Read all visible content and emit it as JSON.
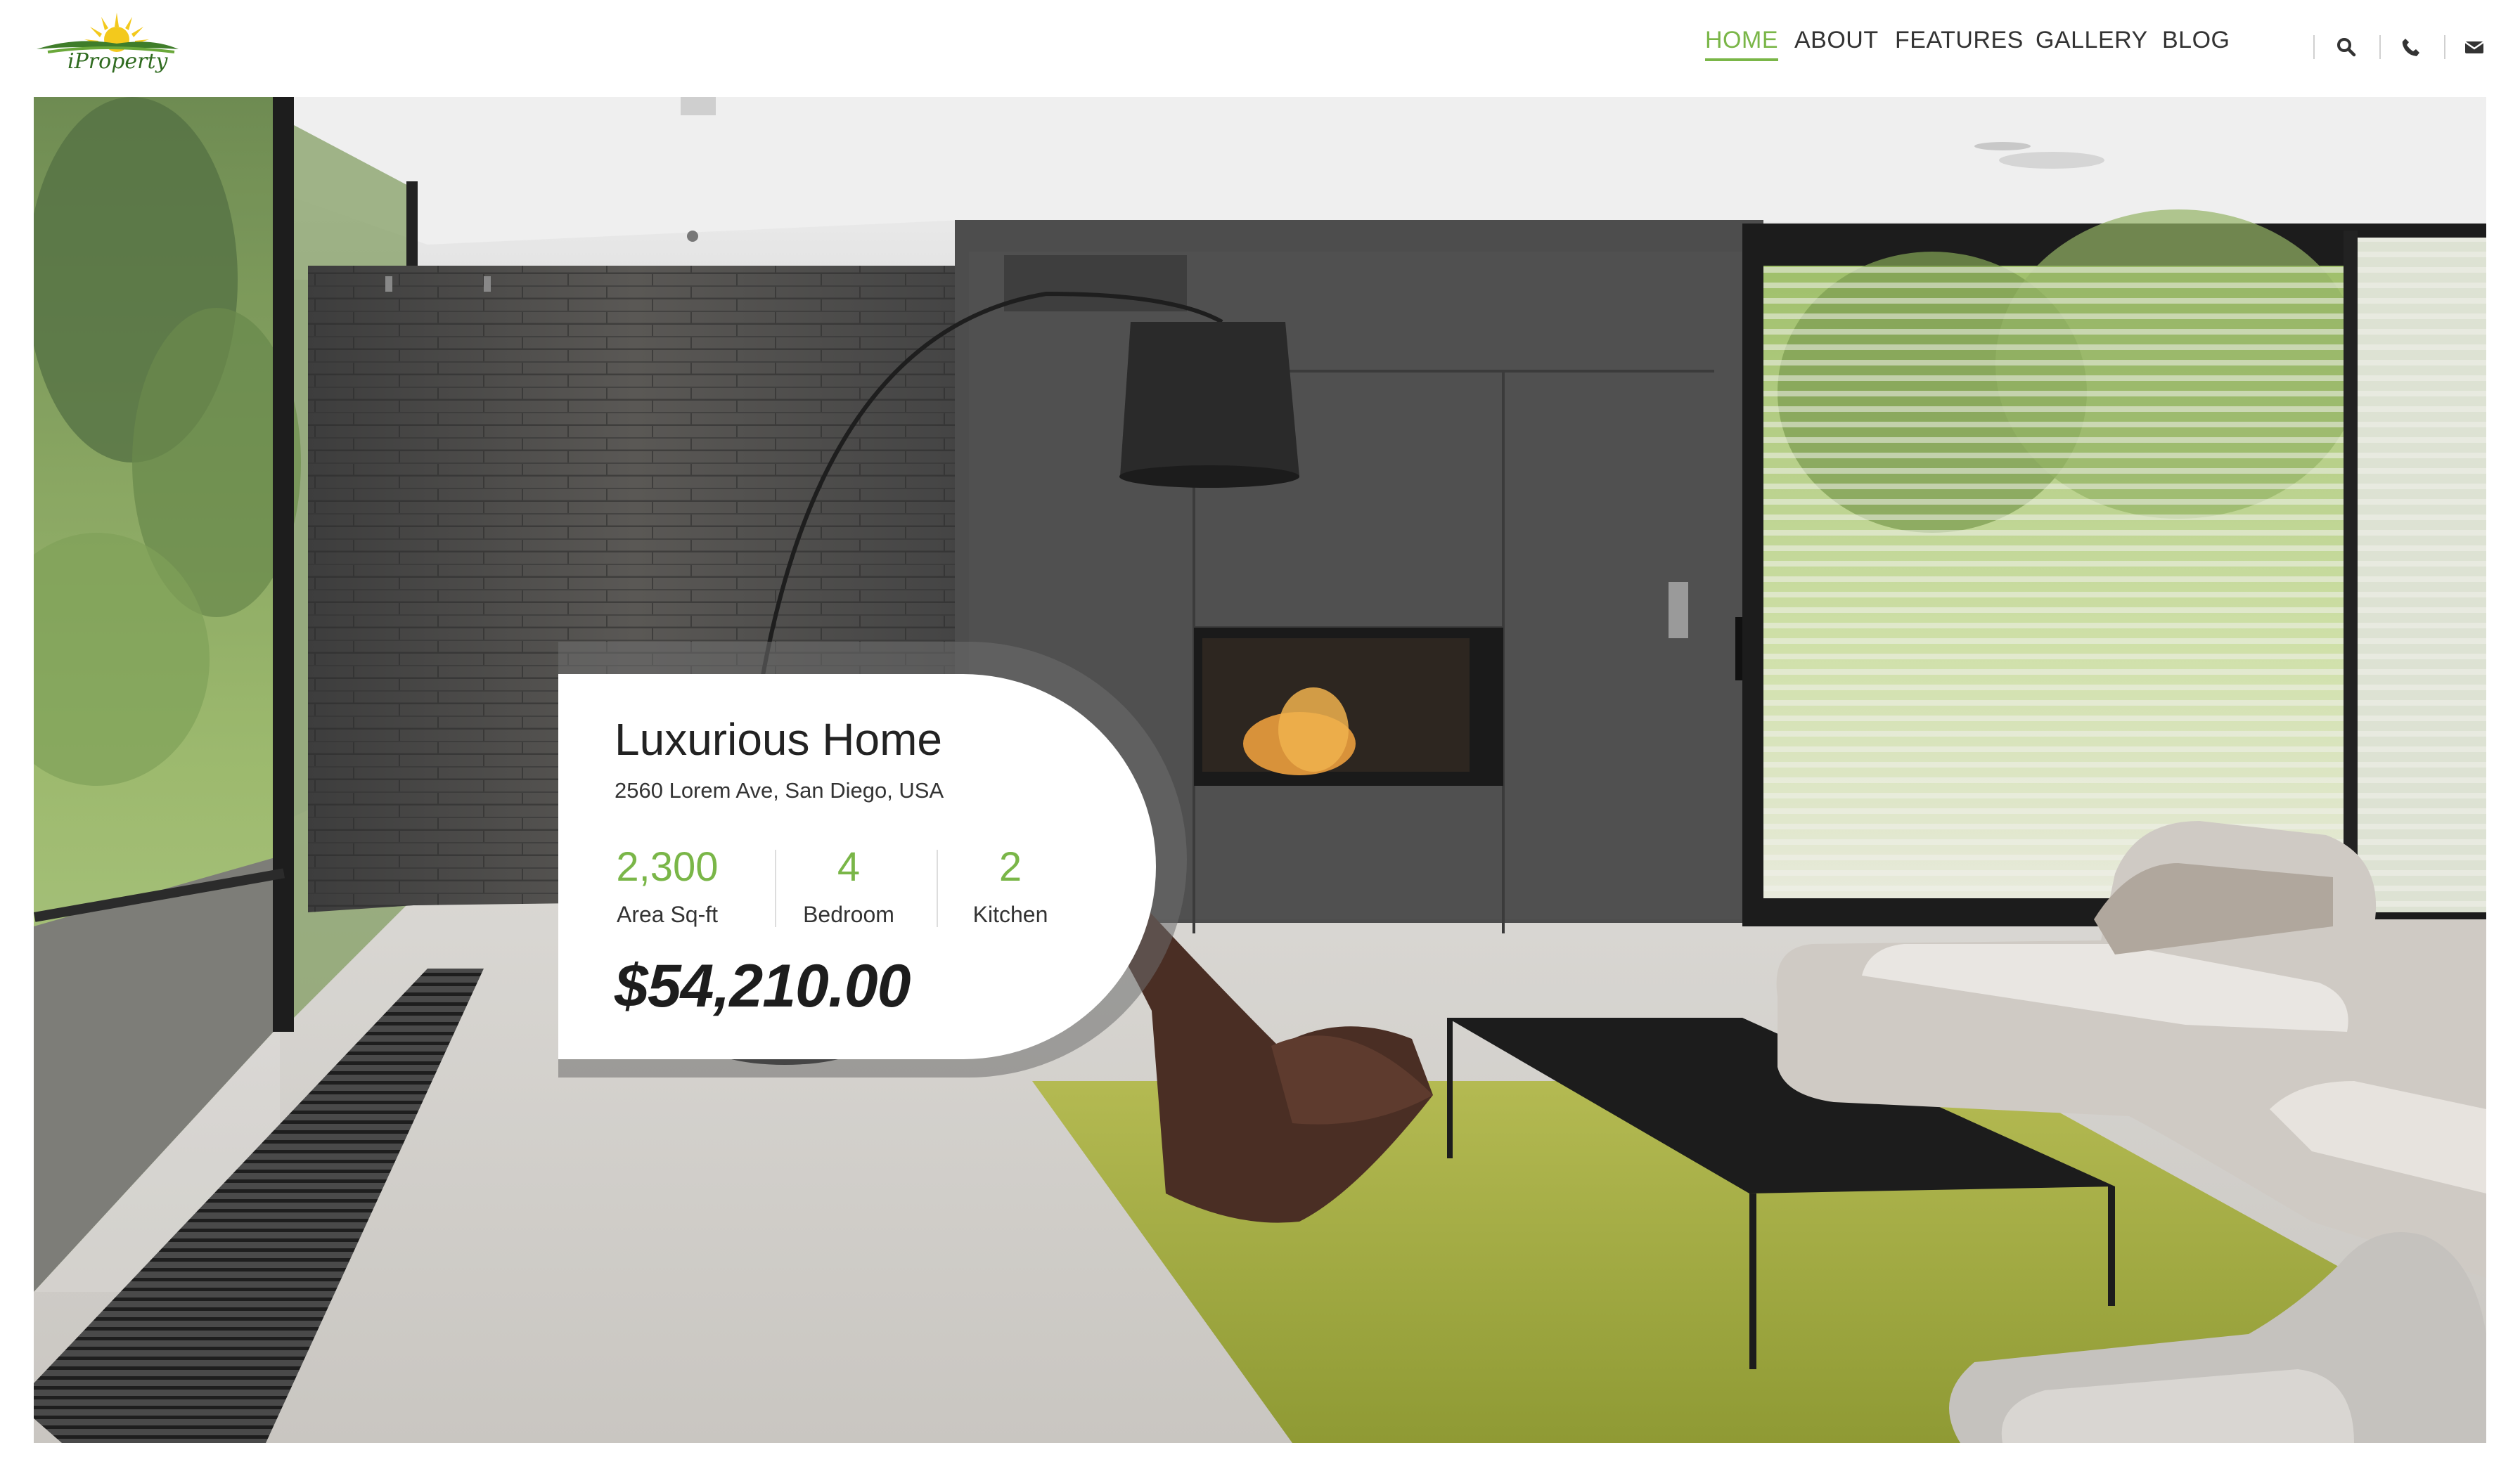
{
  "brand": {
    "name": "iProperty",
    "accent_color": "#7ab648"
  },
  "nav": {
    "items": [
      {
        "label": "HOME",
        "active": true
      },
      {
        "label": "ABOUT",
        "active": false
      },
      {
        "label": "FEATURES",
        "active": false
      },
      {
        "label": "GALLERY",
        "active": false
      },
      {
        "label": "BLOG",
        "active": false
      }
    ],
    "tools": [
      "search-icon",
      "phone-icon",
      "envelope-icon"
    ]
  },
  "listing": {
    "title": "Luxurious Home",
    "address": "2560 Lorem Ave, San Diego, USA",
    "stats": [
      {
        "value": "2,300",
        "label": "Area Sq-ft"
      },
      {
        "value": "4",
        "label": "Bedroom"
      },
      {
        "value": "2",
        "label": "Kitchen"
      }
    ],
    "price": "$54,210.00"
  }
}
